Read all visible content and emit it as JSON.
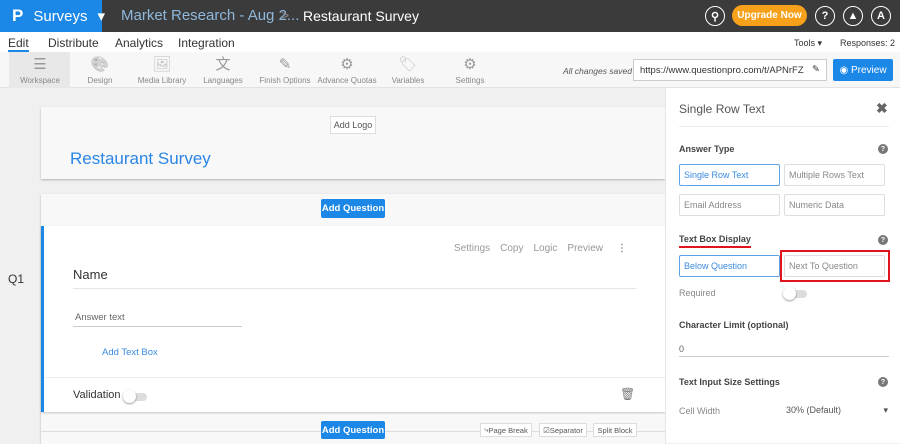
{
  "header": {
    "app": "Surveys",
    "breadcrumb_parent": "Market Research - Aug 2...",
    "breadcrumb_sep": ">",
    "breadcrumb_current": "Restaurant Survey",
    "upgrade": "Upgrade Now",
    "help": "?",
    "avatar": "A"
  },
  "nav": {
    "tabs": [
      "Edit",
      "Distribute",
      "Analytics",
      "Integration"
    ],
    "tools": "Tools ▾",
    "responses": "Responses: 2"
  },
  "toolbar": {
    "items": [
      {
        "label": "Workspace",
        "icon": "☰"
      },
      {
        "label": "Design",
        "icon": "🎨"
      },
      {
        "label": "Media Library",
        "icon": "🖼"
      },
      {
        "label": "Languages",
        "icon": "文"
      },
      {
        "label": "Finish Options",
        "icon": "✎"
      },
      {
        "label": "Advance Quotas",
        "icon": "⚙"
      },
      {
        "label": "Variables",
        "icon": "🏷"
      },
      {
        "label": "Settings",
        "icon": "⚙"
      }
    ],
    "saved": "All changes saved",
    "url": "https://www.questionpro.com/t/APNrFZ",
    "preview": "Preview"
  },
  "survey": {
    "add_logo": "Add Logo",
    "title": "Restaurant Survey",
    "add_question": "Add Question",
    "q_number": "Q1",
    "q_actions": [
      "Settings",
      "Copy",
      "Logic",
      "Preview"
    ],
    "question": "Name",
    "answer_placeholder": "Answer text",
    "add_text_box": "Add Text Box",
    "validation": "Validation",
    "page_break": "Page Break",
    "separator": "Separator",
    "split_block": "Split Block"
  },
  "panel": {
    "title": "Single Row Text",
    "answer_type": "Answer Type",
    "types": [
      "Single Row Text",
      "Multiple Rows Text",
      "Email Address",
      "Numeric Data"
    ],
    "text_box_display": "Text Box Display",
    "displays": [
      "Below Question",
      "Next To Question"
    ],
    "required": "Required",
    "char_limit": "Character Limit (optional)",
    "char_value": "0",
    "size_settings": "Text Input Size Settings",
    "cell_width": "Cell Width",
    "cell_width_value": "30% (Default)"
  },
  "colors": {
    "brand": "#1b87e6",
    "upgrade": "#f7a11a",
    "highlight": "#e0141e"
  }
}
